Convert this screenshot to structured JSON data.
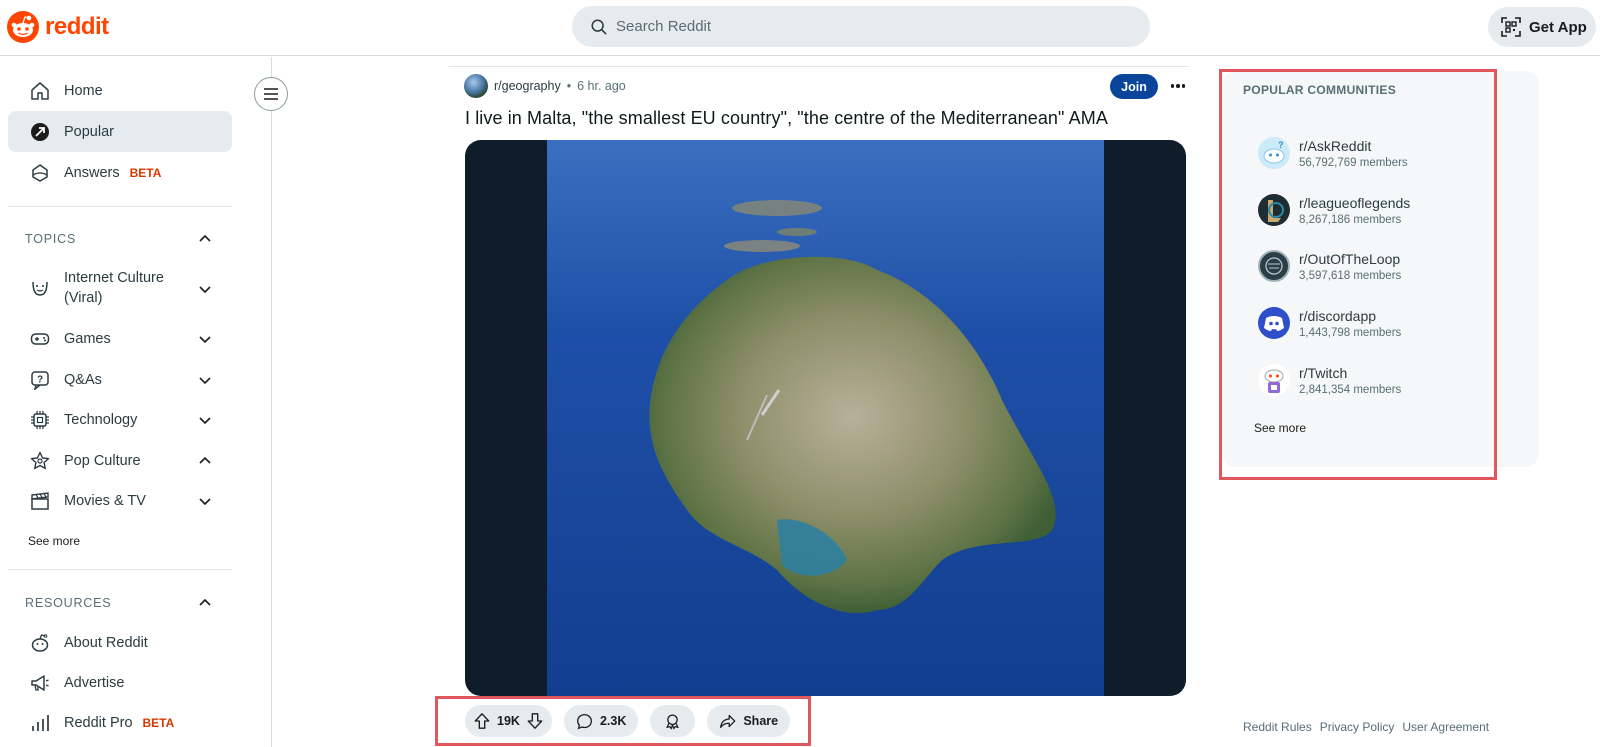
{
  "header": {
    "logo_text": "reddit",
    "search_placeholder": "Search Reddit",
    "get_app_label": "Get App"
  },
  "sidebar": {
    "nav": [
      {
        "label": "Home",
        "icon": "home-icon"
      },
      {
        "label": "Popular",
        "icon": "popular-icon"
      },
      {
        "label": "Answers",
        "icon": "answers-icon",
        "badge": "BETA"
      }
    ],
    "topics_header": "TOPICS",
    "topics": [
      {
        "label": "Internet Culture (Viral)",
        "icon": "smile-icon"
      },
      {
        "label": "Games",
        "icon": "gamepad-icon"
      },
      {
        "label": "Q&As",
        "icon": "question-icon"
      },
      {
        "label": "Technology",
        "icon": "chip-icon"
      },
      {
        "label": "Pop Culture",
        "icon": "star-icon"
      },
      {
        "label": "Movies & TV",
        "icon": "clapper-icon"
      }
    ],
    "topics_see_more": "See more",
    "resources_header": "RESOURCES",
    "resources": [
      {
        "label": "About Reddit",
        "icon": "reddit-icon"
      },
      {
        "label": "Advertise",
        "icon": "megaphone-icon"
      },
      {
        "label": "Reddit Pro",
        "icon": "bar-chart-icon",
        "badge": "BETA"
      }
    ]
  },
  "post": {
    "subreddit": "r/geography",
    "separator": "•",
    "time": "6 hr. ago",
    "join_label": "Join",
    "title": "I live in Malta, \"the smallest EU country\", \"the centre of the Mediterranean\" AMA",
    "upvotes": "19K",
    "comments": "2.3K",
    "share_label": "Share"
  },
  "popular_communities": {
    "title": "POPULAR COMMUNITIES",
    "items": [
      {
        "name": "r/AskReddit",
        "members": "56,792,769 members"
      },
      {
        "name": "r/leagueoflegends",
        "members": "8,267,186 members"
      },
      {
        "name": "r/OutOfTheLoop",
        "members": "3,597,618 members"
      },
      {
        "name": "r/discordapp",
        "members": "1,443,798 members"
      },
      {
        "name": "r/Twitch",
        "members": "2,841,354 members"
      }
    ],
    "see_more": "See more"
  },
  "footer": {
    "links": [
      "Reddit Rules",
      "Privacy Policy",
      "User Agreement"
    ]
  },
  "colors": {
    "brand": "#ff4500",
    "join": "#0a449b",
    "highlight": "#e0585b",
    "beta": "#d93900"
  }
}
